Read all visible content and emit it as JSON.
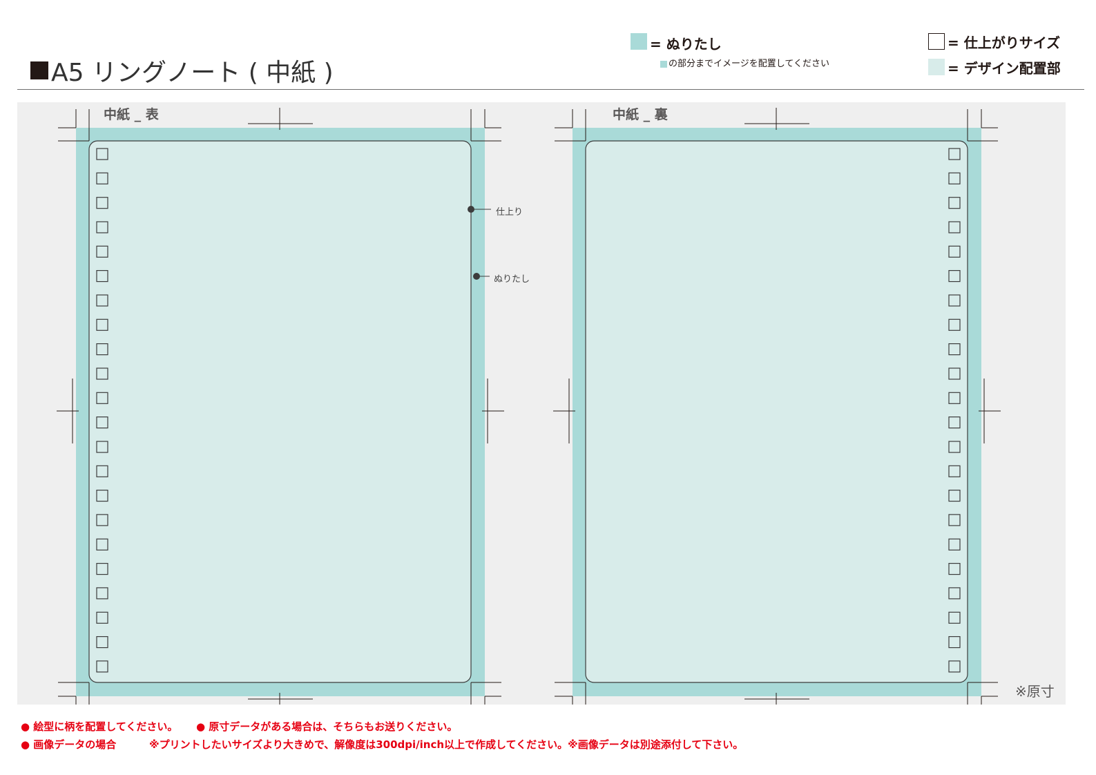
{
  "header": {
    "title": "A5 リングノート ( 中紙 )"
  },
  "legend": {
    "bleed_label": "= ぬりたし",
    "bleed_note": "の部分までイメージを配置してください",
    "trim_label": "= 仕上がりサイズ",
    "design_label": "= デザイン配置部"
  },
  "colors": {
    "bleed": "#a9dad8",
    "design_area": "#d8ecea",
    "background": "#efefef",
    "note_red": "#e60012"
  },
  "sheets": {
    "front_label": "中紙 _ 表",
    "back_label": "中紙 _ 裏",
    "ring_hole_count": 22
  },
  "callouts": {
    "trim": "仕上り",
    "bleed": "ぬりたし"
  },
  "actual_size": "※原寸",
  "notes": {
    "note1": "● 絵型に柄を配置してください。",
    "note2": "● 原寸データがある場合は、そちらもお送りください。",
    "note3": "● 画像データの場合",
    "note4": "※プリントしたいサイズより大きめで、解像度は300dpi/inch以上で作成してください。※画像データは別途添付して下さい。"
  }
}
